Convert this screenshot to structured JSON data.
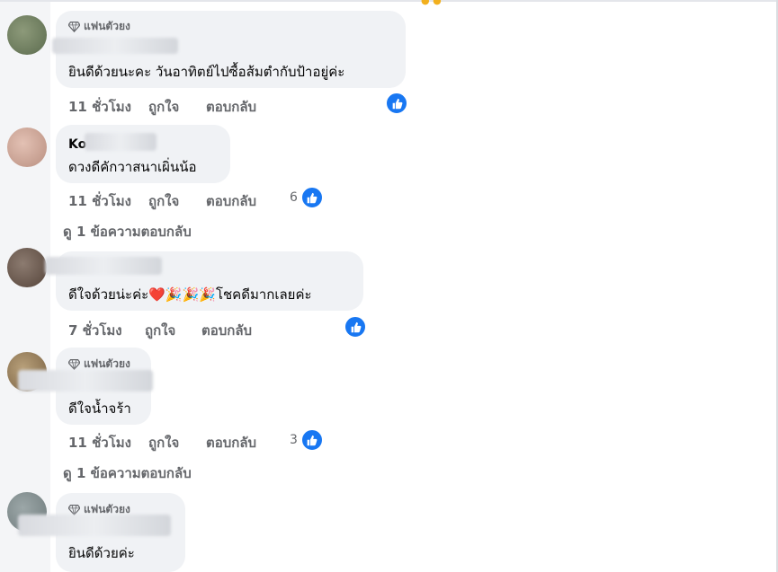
{
  "comments": [
    {
      "badge": "แฟนตัวยง",
      "name": "",
      "text": "ยินดีด้วยนะคะ วันอาทิตย์ไปซื้อส้มตำกับป้าอยู่ค่ะ",
      "time": "11 ชั่วโมง",
      "like": "ถูกใจ",
      "reply": "ตอบกลับ",
      "reaction_count": ""
    },
    {
      "badge": "",
      "name": "Ko",
      "text": "ดวงดีคักวาสนาเผิ่นน้อ",
      "time": "11 ชั่วโมง",
      "like": "ถูกใจ",
      "reply": "ตอบกลับ",
      "reaction_count": "6"
    },
    {
      "badge": "",
      "name": "",
      "text": "ดีใจด้วยน่ะค่ะ",
      "emoji": "❤️🎉🎉🎉",
      "text_after": "โชคดีมากเลยค่ะ",
      "time": "7 ชั่วโมง",
      "like": "ถูกใจ",
      "reply": "ตอบกลับ",
      "reaction_count": ""
    },
    {
      "badge": "แฟนตัวยง",
      "name": "",
      "text": "ดีใจน้ำจร้า",
      "time": "11 ชั่วโมง",
      "like": "ถูกใจ",
      "reply": "ตอบกลับ",
      "reaction_count": "3"
    },
    {
      "badge": "แฟนตัวยง",
      "name": "",
      "text": "ยินดีด้วยค่ะ"
    }
  ],
  "view_replies": [
    "ดู 1 ข้อความตอบกลับ",
    "ดู 1 ข้อความตอบกลับ"
  ],
  "colors": {
    "like_blue": "#1877f2",
    "bubble_bg": "#f0f2f5",
    "meta_gray": "#65676b"
  },
  "icons": {
    "badge": "diamond-icon",
    "reaction": "thumbs-up-icon"
  }
}
